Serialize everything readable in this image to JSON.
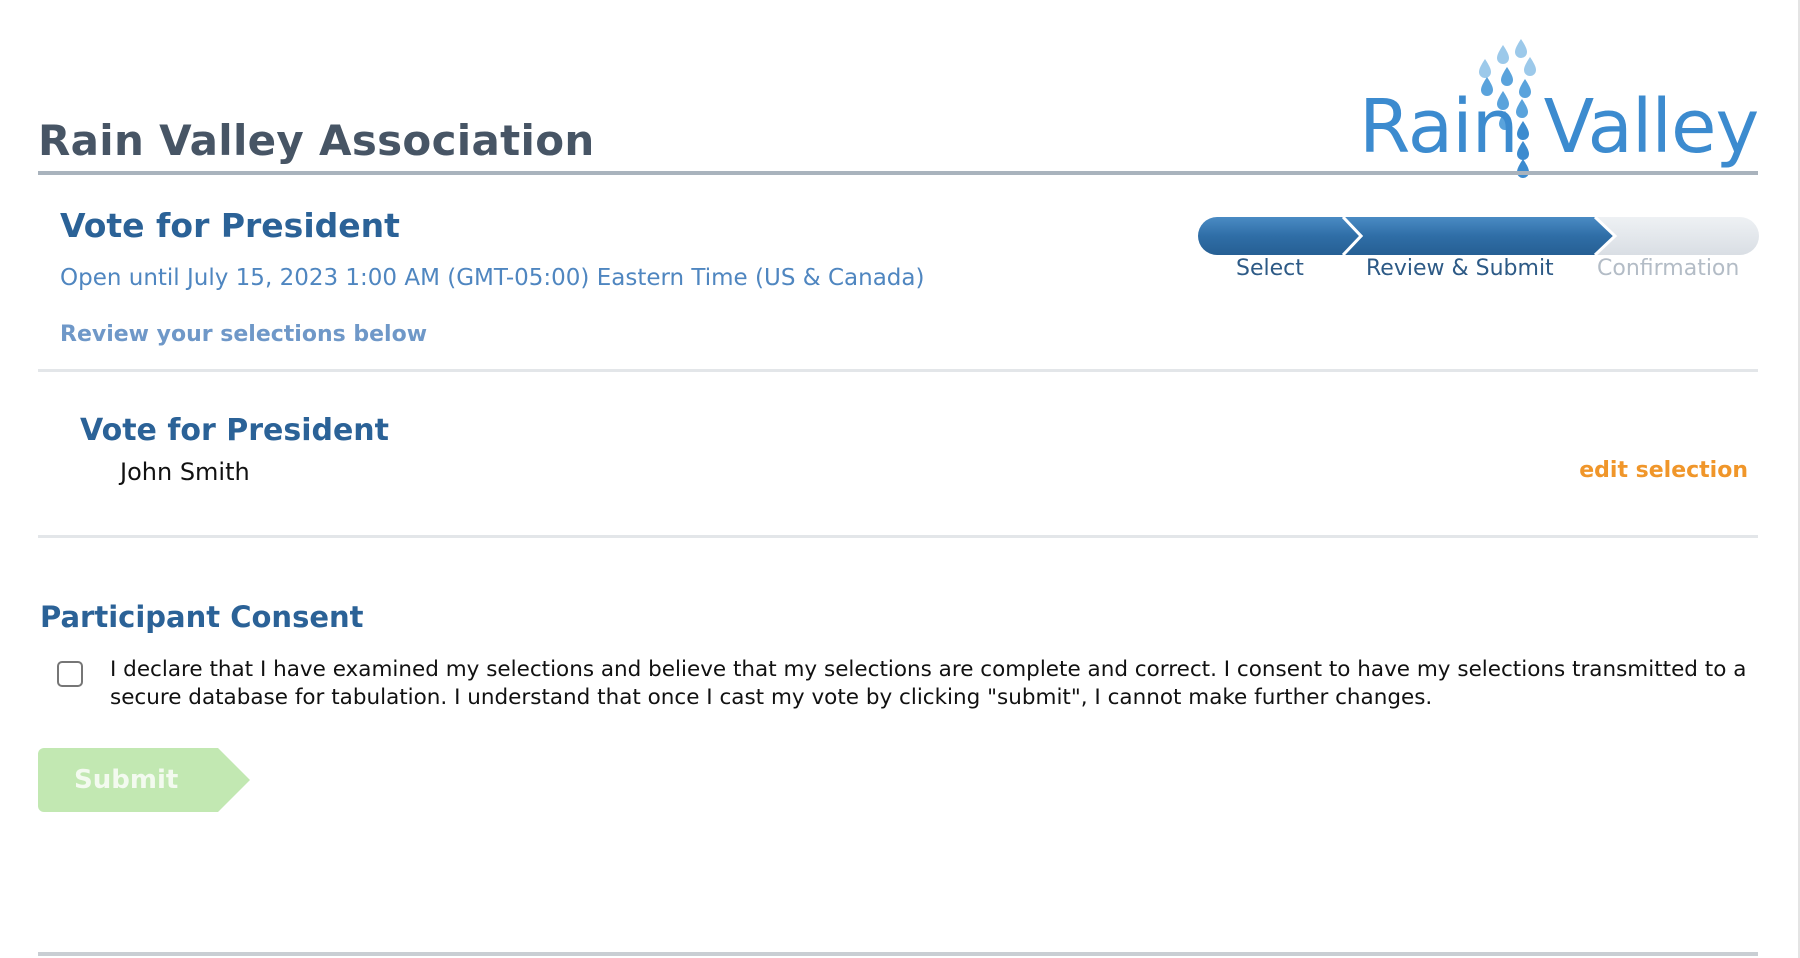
{
  "header": {
    "org_title": "Rain Valley Association",
    "logo_text_left": "Rain",
    "logo_text_right": "Valley",
    "logo_color": "#3c8bcf"
  },
  "ballot": {
    "title": "Vote for President",
    "open_until": "Open until July 15, 2023 1:00 AM (GMT-05:00) Eastern Time (US & Canada)",
    "review_note": "Review your selections below"
  },
  "progress": {
    "steps": [
      {
        "label": "Select",
        "state": "complete"
      },
      {
        "label": "Review & Submit",
        "state": "current"
      },
      {
        "label": "Confirmation",
        "state": "upcoming"
      }
    ],
    "active_color": "#2f6ea7",
    "inactive_color": "#e1e5ea"
  },
  "selection": {
    "contest": "Vote for President",
    "choice": "John Smith",
    "edit_label": "edit selection"
  },
  "consent": {
    "title": "Participant Consent",
    "checked": false,
    "text": "I declare that I have examined my selections and believe that my selections are complete and correct. I consent to have my selections transmitted to a secure database for tabulation. I understand that once I cast my vote by clicking \"submit\", I cannot make further changes."
  },
  "submit": {
    "label": "Submit",
    "disabled": true,
    "color": "#c2e8b2"
  }
}
